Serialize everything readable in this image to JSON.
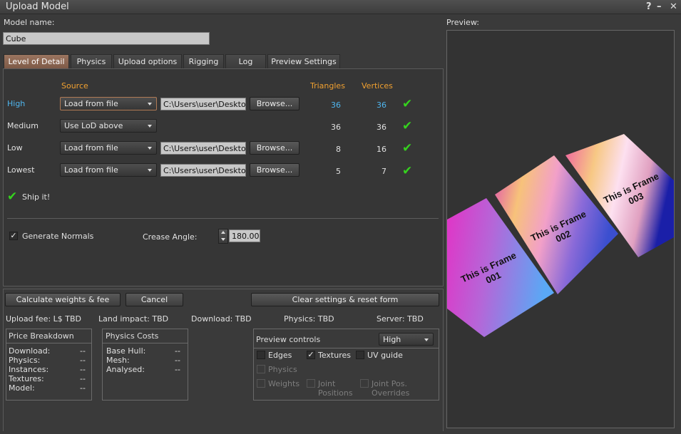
{
  "window": {
    "title": "Upload Model",
    "help_label": "?",
    "minimize_label": "–",
    "close_label": "✕"
  },
  "model_name": {
    "label": "Model name:",
    "value": "Cube"
  },
  "tabs": [
    {
      "label": "Level of Detail"
    },
    {
      "label": "Physics"
    },
    {
      "label": "Upload options"
    },
    {
      "label": "Rigging"
    },
    {
      "label": "Log"
    },
    {
      "label": "Preview Settings"
    }
  ],
  "lod": {
    "headers": {
      "source": "Source",
      "triangles": "Triangles",
      "vertices": "Vertices"
    },
    "rows": [
      {
        "name": "High",
        "source": "Load from file",
        "path": "C:\\Users\\user\\Desktop",
        "browse": "Browse...",
        "triangles": "36",
        "vertices": "36"
      },
      {
        "name": "Medium",
        "source": "Use LoD above",
        "path": "",
        "browse": "",
        "triangles": "36",
        "vertices": "36"
      },
      {
        "name": "Low",
        "source": "Load from file",
        "path": "C:\\Users\\user\\Desktop",
        "browse": "Browse...",
        "triangles": "8",
        "vertices": "16"
      },
      {
        "name": "Lowest",
        "source": "Load from file",
        "path": "C:\\Users\\user\\Desktop",
        "browse": "Browse...",
        "triangles": "5",
        "vertices": "7"
      }
    ],
    "status_icon": "green-check-icon",
    "ship_it": "Ship it!",
    "generate_normals": "Generate Normals",
    "crease_angle_label": "Crease Angle:",
    "crease_angle_value": "180.000"
  },
  "actions": {
    "calculate": "Calculate weights & fee",
    "cancel": "Cancel",
    "clear": "Clear settings & reset form"
  },
  "stats": {
    "upload_fee": "Upload fee: L$ TBD",
    "land_impact": "Land impact: TBD",
    "download": "Download: TBD",
    "physics": "Physics: TBD",
    "server": "Server: TBD"
  },
  "price_breakdown": {
    "title": "Price Breakdown",
    "items": [
      {
        "label": "Download:",
        "value": "--"
      },
      {
        "label": "Physics:",
        "value": "--"
      },
      {
        "label": "Instances:",
        "value": "--"
      },
      {
        "label": "Textures:",
        "value": "--"
      },
      {
        "label": "Model:",
        "value": "--"
      }
    ]
  },
  "physics_costs": {
    "title": "Physics Costs",
    "items": [
      {
        "label": "Base Hull:",
        "value": "--"
      },
      {
        "label": "Mesh:",
        "value": "--"
      },
      {
        "label": "Analysed:",
        "value": "--"
      }
    ]
  },
  "preview_controls": {
    "title": "Preview controls",
    "lod_select": "High",
    "edges": "Edges",
    "textures": "Textures",
    "uv_guide": "UV guide",
    "physics": "Physics",
    "weights": "Weights",
    "joint_positions_1": "Joint",
    "joint_positions_2": "Positions",
    "joint_overrides_1": "Joint Pos.",
    "joint_overrides_2": "Overrides"
  },
  "preview": {
    "label": "Preview:",
    "frames": [
      {
        "line1": "This is Frame",
        "line2": "001"
      },
      {
        "line1": "This is Frame",
        "line2": "002"
      },
      {
        "line1": "This is Frame",
        "line2": "003"
      }
    ]
  }
}
